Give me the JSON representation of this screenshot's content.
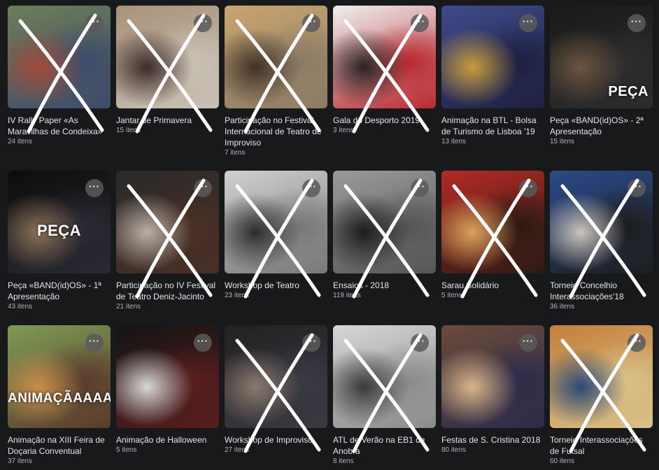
{
  "more_label": "···",
  "cross_color": "#ffffff",
  "albums": [
    {
      "title": "IV Rally Paper «As Maravilhas de Condeixa»",
      "count": "24 itens",
      "crossed": true,
      "photo": [
        "#6e7d59",
        "#a14b3a",
        "#3d4a6a"
      ]
    },
    {
      "title": "Jantar de Primavera",
      "count": "15 itens",
      "crossed": true,
      "photo": [
        "#a99279",
        "#3b2a29",
        "#c9c1b6"
      ]
    },
    {
      "title": "Participação no Festival Internacional de Teatro de Improviso",
      "count": "7 itens",
      "crossed": true,
      "photo": [
        "#c9a56f",
        "#403026",
        "#8a7a66"
      ]
    },
    {
      "title": "Gala do Desporto 2019",
      "count": "3 itens",
      "crossed": true,
      "photo": [
        "#efefef",
        "#2a2424",
        "#b8292f"
      ]
    },
    {
      "title": "Animação na BTL - Bolsa de Turismo de Lisboa '19",
      "count": "13 itens",
      "crossed": false,
      "photo": [
        "#3e4b8a",
        "#c89b3c",
        "#1e2040"
      ]
    },
    {
      "title": "Peça «BAND(id)OS» - 2ª Apresentação",
      "count": "15 itens",
      "crossed": false,
      "photo": [
        "#1a1a1a",
        "#6b5540",
        "#2d2d2d"
      ],
      "overlay": "PEÇA",
      "overlay_pos": "br"
    },
    {
      "title": "Peça «BAND(id)OS» - 1ª Apresentação",
      "count": "43 itens",
      "crossed": false,
      "photo": [
        "#0d0d0d",
        "#8a7258",
        "#2a2a33"
      ],
      "overlay": "PEÇA",
      "overlay_pos": "center"
    },
    {
      "title": "Participação no IV Festival de Teatro Deniz-Jacinto",
      "count": "21 itens",
      "crossed": true,
      "photo": [
        "#2a2a2a",
        "#b9b0a4",
        "#4a2f25"
      ]
    },
    {
      "title": "Workshop de Teatro",
      "count": "23 itens",
      "crossed": true,
      "photo": [
        "#d0d0d0",
        "#2c2c2c",
        "#777777"
      ]
    },
    {
      "title": "Ensaios - 2018",
      "count": "119 itens",
      "crossed": true,
      "photo": [
        "#9a9a9a",
        "#1c1c1c",
        "#555555"
      ]
    },
    {
      "title": "Sarau Solidário",
      "count": "5 itens",
      "crossed": true,
      "photo": [
        "#b52a24",
        "#d9a35a",
        "#2a1a14"
      ]
    },
    {
      "title": "Torneio Concelhio Interassociações'18",
      "count": "36 itens",
      "crossed": true,
      "photo": [
        "#2b4a8a",
        "#c9c4bd",
        "#1d1d1d"
      ]
    },
    {
      "title": "Animação na XIII Feira de Doçaria Conventual",
      "count": "37 itens",
      "crossed": false,
      "photo": [
        "#7e9a55",
        "#c98c4a",
        "#5a3a2c"
      ],
      "overlay": "ANIMAÇÃAAAAAO",
      "overlay_pos": "lower"
    },
    {
      "title": "Animação de Halloween",
      "count": "5 itens",
      "crossed": false,
      "photo": [
        "#141414",
        "#d8d8d8",
        "#5a1e1e"
      ]
    },
    {
      "title": "Workshop de Improviso",
      "count": "27 itens",
      "crossed": true,
      "photo": [
        "#222222",
        "#8a7a6e",
        "#3a3a44"
      ]
    },
    {
      "title": "ATL de Verão na EB1 de Anobra",
      "count": "8 itens",
      "crossed": true,
      "photo": [
        "#d6d6d6",
        "#3a3a3a",
        "#8a8a8a"
      ]
    },
    {
      "title": "Festas de S. Cristina 2018",
      "count": "80 itens",
      "crossed": false,
      "photo": [
        "#6b4a3a",
        "#d8b48a",
        "#2b2b4a"
      ]
    },
    {
      "title": "Torneio Interassociações de Futsal",
      "count": "60 itens",
      "crossed": true,
      "photo": [
        "#c4803a",
        "#2b4a7a",
        "#d9c28a"
      ]
    }
  ]
}
